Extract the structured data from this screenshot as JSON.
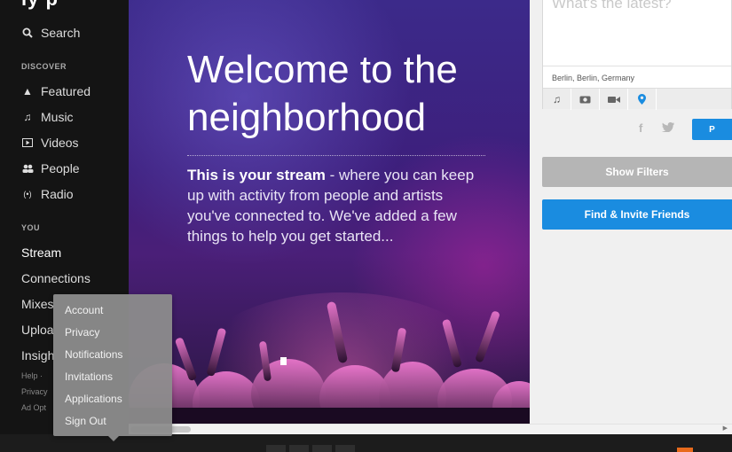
{
  "sidebar": {
    "logo_fragment": "iy p",
    "search_label": "Search",
    "discover_heading": "DISCOVER",
    "discover_items": [
      {
        "label": "Featured",
        "icon": "flame-icon"
      },
      {
        "label": "Music",
        "icon": "music-note-icon"
      },
      {
        "label": "Videos",
        "icon": "video-icon"
      },
      {
        "label": "People",
        "icon": "people-icon"
      },
      {
        "label": "Radio",
        "icon": "radio-icon"
      }
    ],
    "you_heading": "YOU",
    "you_items": [
      "Stream",
      "Connections",
      "Mixes",
      "Uploa",
      "Insigh"
    ],
    "footer_links": [
      "Help ·",
      "Privacy",
      "Ad Opt"
    ]
  },
  "hero": {
    "title": "Welcome to the neighborhood",
    "body_bold": "This is your stream",
    "body_rest": " - where you can keep up with activity from people and artists you've connected to. We've added a few things to help you get started..."
  },
  "composer": {
    "placeholder": "What's the latest?",
    "location": "Berlin, Berlin, Germany",
    "media_icons": [
      "music-note-icon",
      "camera-icon",
      "video-camera-icon",
      "location-pin-icon"
    ],
    "post_label": "P"
  },
  "buttons": {
    "show_filters": "Show Filters",
    "find_invite": "Find & Invite Friends"
  },
  "account_menu": {
    "items": [
      "Account",
      "Privacy",
      "Notifications",
      "Invitations",
      "Applications",
      "Sign Out"
    ]
  },
  "colors": {
    "accent_blue": "#1a8ce0",
    "sidebar_bg": "#141414",
    "filters_gray": "#b5b5b5"
  }
}
